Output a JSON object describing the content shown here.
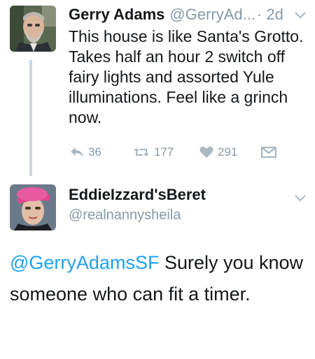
{
  "tweet_1": {
    "display_name": "Gerry Adams",
    "handle": "@GerryAd...",
    "time": "· 2d",
    "text": "This house is like Santa's Grotto. Takes half an hour 2 switch off fairy lights and assorted Yule illuminations. Feel like a grinch now.",
    "actions": {
      "reply_count": "36",
      "retweet_count": "177",
      "like_count": "291"
    }
  },
  "tweet_2": {
    "display_name": "EddieIzzard'sBeret",
    "handle": "@realnannysheila",
    "mention": "@GerryAdamsSF",
    "text": " Surely you know someone who can fit a timer."
  },
  "icons": {
    "reply": "reply-icon",
    "retweet": "retweet-icon",
    "like": "heart-icon",
    "message": "direct-message-icon",
    "more": "chevron-down-icon"
  },
  "colors": {
    "link": "#1da1f2",
    "secondary_text": "#8899a6",
    "thread_line": "#ccd6dd"
  }
}
